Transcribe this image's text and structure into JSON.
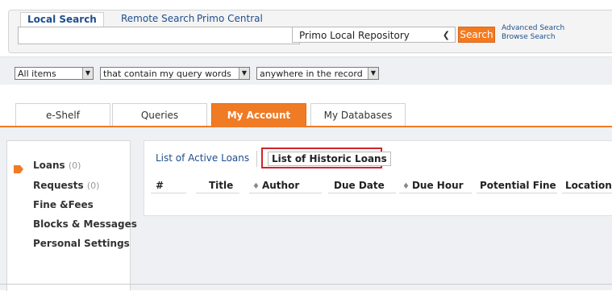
{
  "search_tabs": [
    "Local Search",
    "Remote Search",
    "Primo Central"
  ],
  "search": {
    "query_value": "",
    "scope_selected": "Primo Local Repository",
    "search_label": "Search",
    "advanced_label": "Advanced Search",
    "browse_label": "Browse Search"
  },
  "refine": {
    "items_selected": "All items",
    "match_selected": "that contain my query words",
    "field_selected": "anywhere in the record"
  },
  "account_tabs": [
    "e-Shelf",
    "Queries",
    "My Account",
    "My Databases"
  ],
  "left_nav": {
    "loans_label": "Loans",
    "loans_count": "(0)",
    "requests_label": "Requests",
    "requests_count": "(0)",
    "fines_label": "Fine &Fees",
    "blocks_label": "Blocks & Messages",
    "settings_label": "Personal Settings"
  },
  "loans": {
    "active_tab": "List of Active Loans",
    "historic_tab": "List of Historic Loans",
    "columns": [
      "#",
      "Title",
      "Author",
      "Due Date",
      "Due Hour",
      "Potential Fine",
      "Location"
    ]
  },
  "colors": {
    "accent": "#f07b25",
    "link": "#1f4e8c",
    "highlight": "#d2232a"
  }
}
